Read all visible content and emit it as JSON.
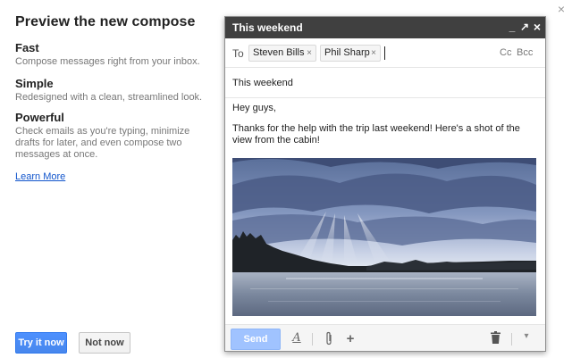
{
  "dialog": {
    "close_glyph": "×"
  },
  "promo": {
    "title": "Preview the new compose",
    "features": [
      {
        "title": "Fast",
        "desc": "Compose messages right from your inbox."
      },
      {
        "title": "Simple",
        "desc": "Redesigned with a clean, streamlined look."
      },
      {
        "title": "Powerful",
        "desc": "Check emails as you're typing, minimize drafts for later, and even compose two messages at once."
      }
    ],
    "learn_more": "Learn More",
    "try_button": "Try it now",
    "not_now_button": "Not now"
  },
  "compose": {
    "window_title": "This weekend",
    "header_icons": {
      "minimize": "_",
      "popout": "↗",
      "close": "×"
    },
    "to_label": "To",
    "recipients": [
      "Steven Bills",
      "Phil Sharp"
    ],
    "chip_remove_glyph": "×",
    "cc_label": "Cc",
    "bcc_label": "Bcc",
    "subject": "This weekend",
    "body": {
      "greeting": "Hey guys,",
      "message": "Thanks for the help with the trip last weekend!  Here's a shot of the view from the cabin!"
    },
    "footer": {
      "send_label": "Send",
      "format_icon": "A",
      "attach_icon": "paperclip-icon",
      "insert_icon": "+",
      "trash_icon": "trash-icon",
      "more_icon": "▾"
    }
  },
  "colors": {
    "header_bg": "#404040",
    "primary_button": "#4d90fe",
    "send_button_disabled": "#a0c3ff",
    "link": "#1155cc"
  }
}
